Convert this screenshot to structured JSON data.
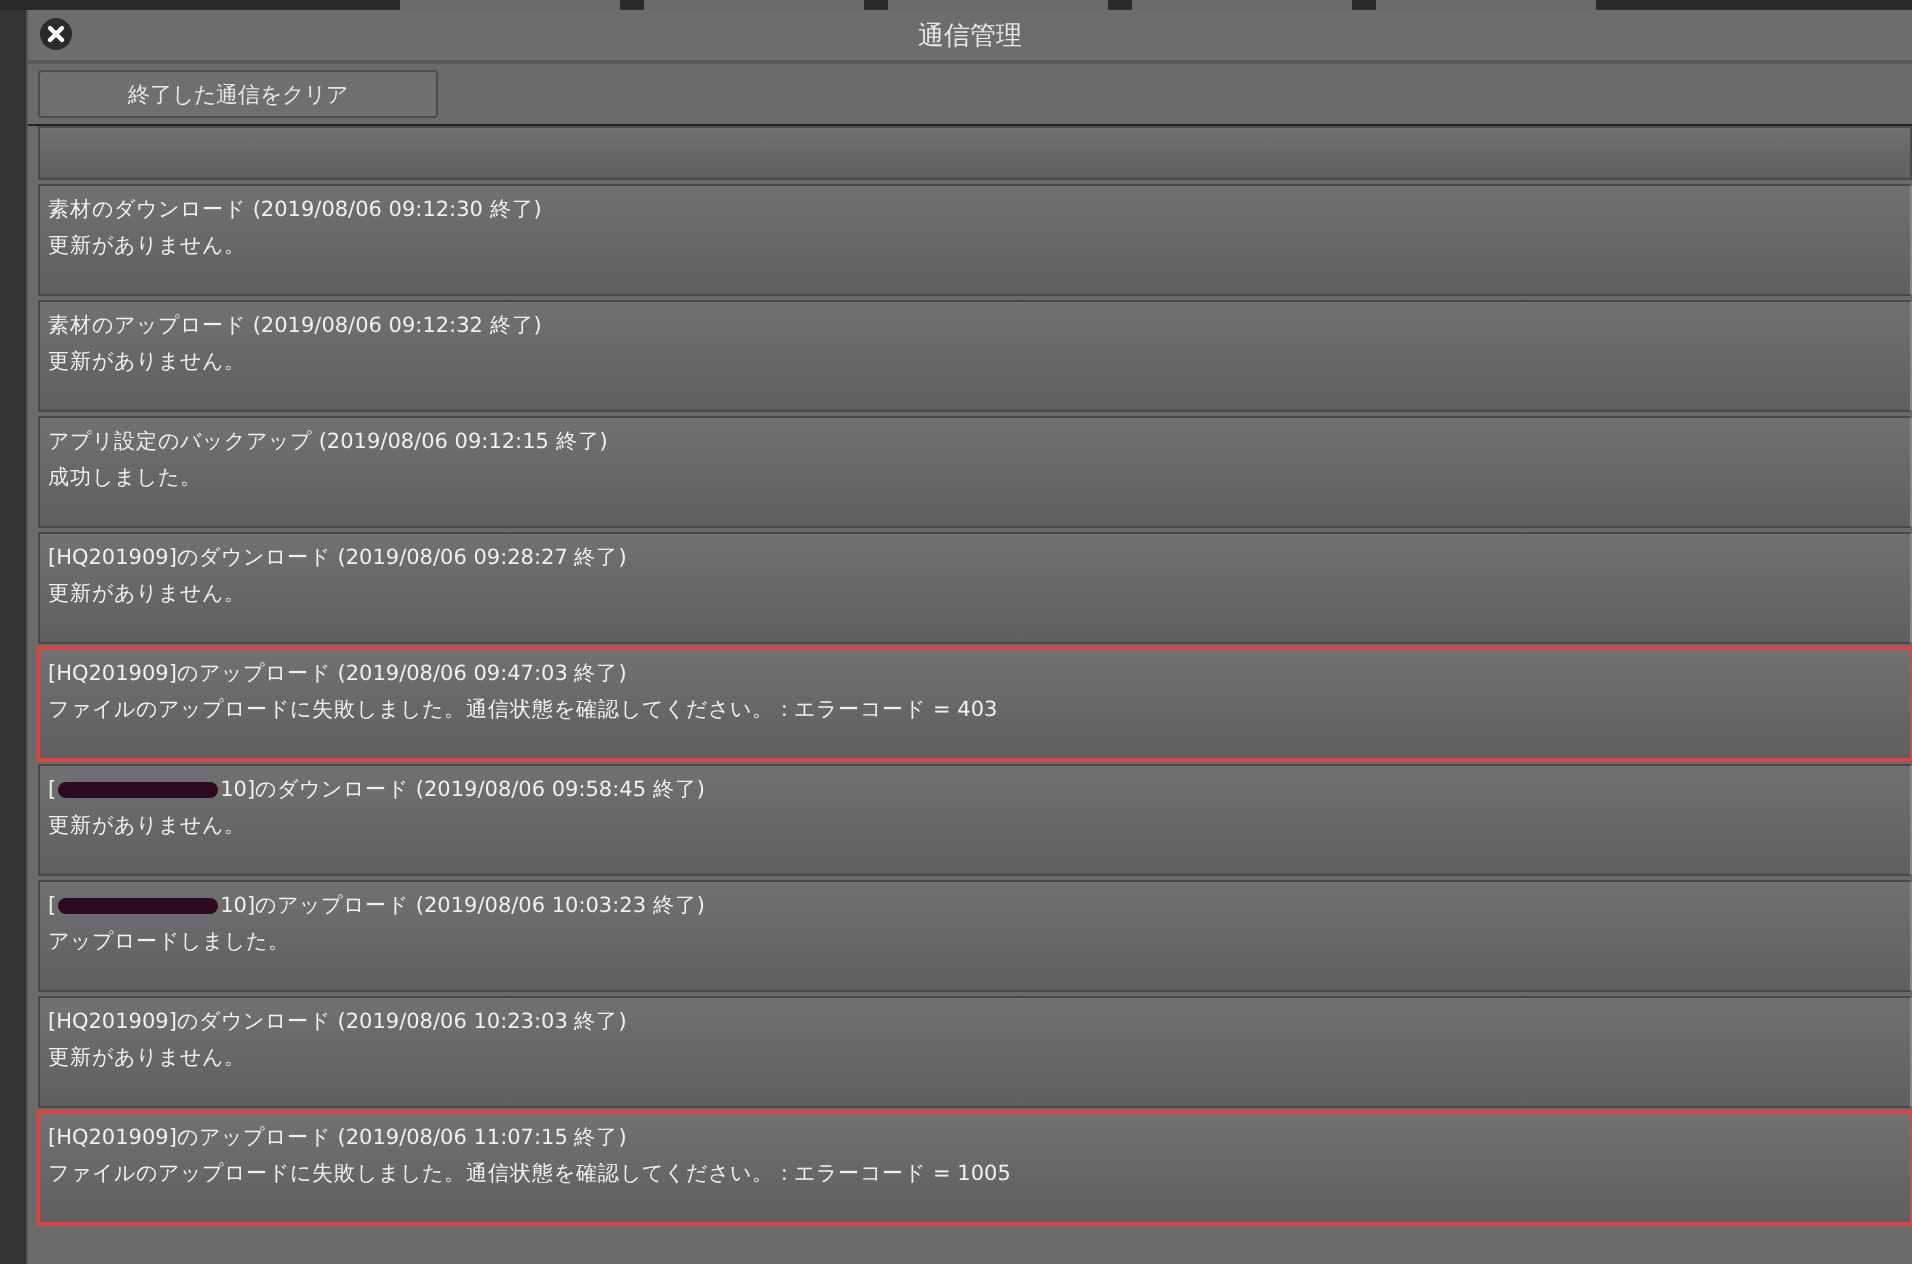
{
  "window": {
    "title": "通信管理"
  },
  "clear_button": {
    "label": "終了した通信をクリア"
  },
  "transfers": [
    {
      "title": "素材のダウンロード (2019/08/06 09:12:30 終了)",
      "message": "更新がありません。",
      "highlighted": false,
      "redacted": false
    },
    {
      "title": "素材のアップロード (2019/08/06 09:12:32 終了)",
      "message": "更新がありません。",
      "highlighted": false,
      "redacted": false
    },
    {
      "title": "アプリ設定のバックアップ (2019/08/06 09:12:15 終了)",
      "message": "成功しました。",
      "highlighted": false,
      "redacted": false
    },
    {
      "title": "[HQ201909]のダウンロード (2019/08/06 09:28:27 終了)",
      "message": "更新がありません。",
      "highlighted": false,
      "redacted": false
    },
    {
      "title": "[HQ201909]のアップロード (2019/08/06 09:47:03 終了)",
      "message": "ファイルのアップロードに失敗しました。通信状態を確認してください。 : エラーコード = 403",
      "highlighted": true,
      "redacted": false
    },
    {
      "title_prefix": "[",
      "title": "10]のダウンロード (2019/08/06 09:58:45 終了)",
      "message": "更新がありません。",
      "highlighted": false,
      "redacted": true
    },
    {
      "title_prefix": "[",
      "title": "10]のアップロード (2019/08/06 10:03:23 終了)",
      "message": "アップロードしました。",
      "highlighted": false,
      "redacted": true
    },
    {
      "title": "[HQ201909]のダウンロード (2019/08/06 10:23:03 終了)",
      "message": "更新がありません。",
      "highlighted": false,
      "redacted": false
    },
    {
      "title": "[HQ201909]のアップロード (2019/08/06 11:07:15 終了)",
      "message": "ファイルのアップロードに失敗しました。通信状態を確認してください。 : エラーコード = 1005",
      "highlighted": true,
      "redacted": false
    }
  ]
}
